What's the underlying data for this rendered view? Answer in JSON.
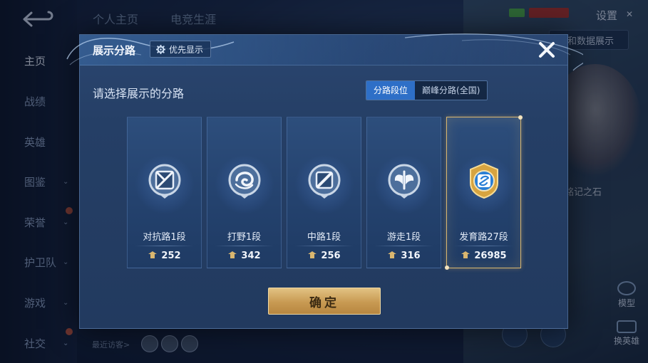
{
  "background": {
    "top_tabs": [
      "个人主页",
      "电竞生涯"
    ],
    "settings_label": "设置",
    "sidebar_items": [
      {
        "label": "主页",
        "active": true,
        "chevron": false,
        "dot": false
      },
      {
        "label": "战绩",
        "active": false,
        "chevron": false,
        "dot": false
      },
      {
        "label": "英雄",
        "active": false,
        "chevron": false,
        "dot": false
      },
      {
        "label": "图鉴",
        "active": false,
        "chevron": true,
        "dot": false
      },
      {
        "label": "荣誉",
        "active": false,
        "chevron": true,
        "dot": true
      },
      {
        "label": "护卫队",
        "active": false,
        "chevron": true,
        "dot": false
      },
      {
        "label": "游戏",
        "active": false,
        "chevron": true,
        "dot": false
      },
      {
        "label": "社交",
        "active": false,
        "chevron": true,
        "dot": true
      }
    ],
    "data_display_label": "息和数据展示",
    "stone_label": "铭记之石",
    "model_label": "模型",
    "switch_hero_label": "换英雄",
    "recent_visitors_label": "最近访客>"
  },
  "modal": {
    "title": "展示分路",
    "priority_button": "优先显示",
    "prompt": "请选择展示的分路",
    "tabs": [
      {
        "label": "分路段位",
        "active": true
      },
      {
        "label": "巅峰分路(全国)",
        "active": false
      }
    ],
    "cards": [
      {
        "label": "对抗路1段",
        "score": "252",
        "selected": false,
        "emblem": "sword-cross-emblem-icon"
      },
      {
        "label": "打野1段",
        "score": "342",
        "selected": false,
        "emblem": "swirl-emblem-icon"
      },
      {
        "label": "中路1段",
        "score": "256",
        "selected": false,
        "emblem": "staff-emblem-icon"
      },
      {
        "label": "游走1段",
        "score": "316",
        "selected": false,
        "emblem": "wings-emblem-icon"
      },
      {
        "label": "发育路27段",
        "score": "26985",
        "selected": true,
        "emblem": "gold-shield-emblem-icon"
      }
    ],
    "confirm_button": "确定"
  },
  "colors": {
    "accent_blue": "#2e6fc7",
    "gold": "#d9b66f"
  }
}
